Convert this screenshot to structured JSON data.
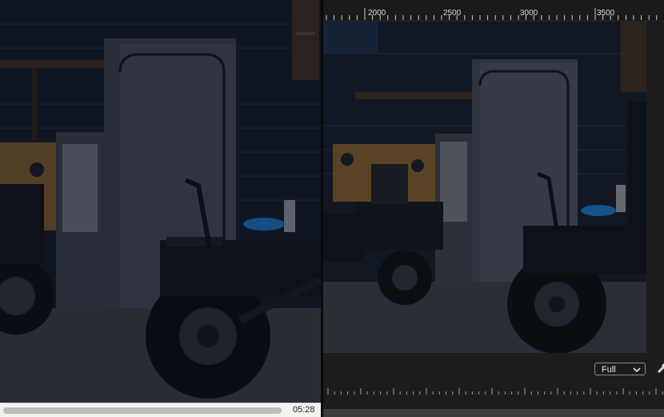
{
  "left_monitor": {
    "timecode": "05:28",
    "scene": "motorcycles-in-garage"
  },
  "program_monitor": {
    "ruler_labels": [
      "2000",
      "2500",
      "3000",
      "3500"
    ],
    "zoom": {
      "selected": "Full",
      "icon": "chevron-down-icon"
    },
    "settings_icon": "wrench-icon",
    "scene": "motorcycles-in-garage"
  },
  "colors": {
    "panel_bg": "#1c1c1c",
    "dark_bg": "#0b0f17",
    "text": "#ececec"
  }
}
